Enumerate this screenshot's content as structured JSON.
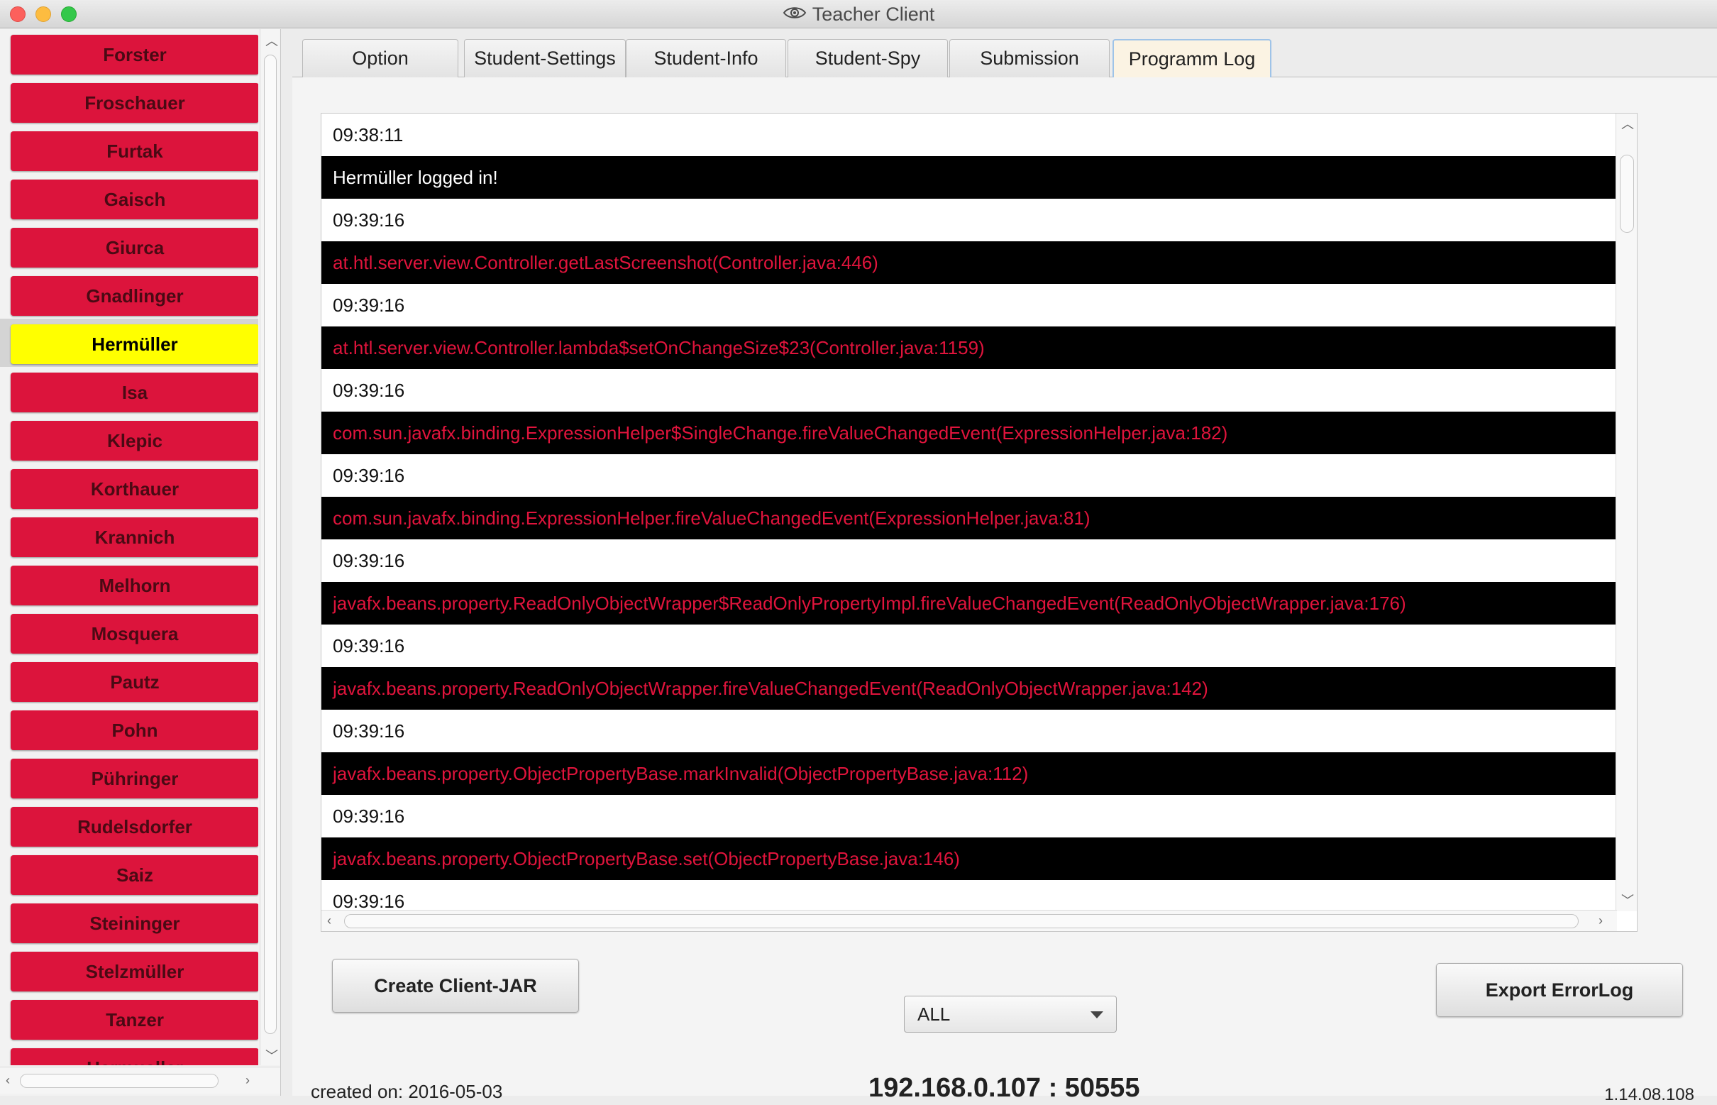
{
  "window": {
    "title": "Teacher Client",
    "title_icon": "eye-icon"
  },
  "sidebar": {
    "students": [
      {
        "name": "Forster",
        "selected": false
      },
      {
        "name": "Froschauer",
        "selected": false
      },
      {
        "name": "Furtak",
        "selected": false
      },
      {
        "name": "Gaisch",
        "selected": false
      },
      {
        "name": "Giurca",
        "selected": false
      },
      {
        "name": "Gnadlinger",
        "selected": false
      },
      {
        "name": "Hermüller",
        "selected": true
      },
      {
        "name": "Isa",
        "selected": false
      },
      {
        "name": "Klepic",
        "selected": false
      },
      {
        "name": "Korthauer",
        "selected": false
      },
      {
        "name": "Krannich",
        "selected": false
      },
      {
        "name": "Melhorn",
        "selected": false
      },
      {
        "name": "Mosquera",
        "selected": false
      },
      {
        "name": "Pautz",
        "selected": false
      },
      {
        "name": "Pohn",
        "selected": false
      },
      {
        "name": "Pühringer",
        "selected": false
      },
      {
        "name": "Rudelsdorfer",
        "selected": false
      },
      {
        "name": "Saiz",
        "selected": false
      },
      {
        "name": "Steininger",
        "selected": false
      },
      {
        "name": "Stelzmüller",
        "selected": false
      },
      {
        "name": "Tanzer",
        "selected": false
      },
      {
        "name": "Hermueller",
        "selected": false
      }
    ],
    "colors": {
      "student": "#dc143c",
      "selected": "#ffff00"
    }
  },
  "tabs": [
    {
      "label": "Option",
      "active": false
    },
    {
      "label": "Student-Settings",
      "active": false
    },
    {
      "label": "Student-Info",
      "active": false
    },
    {
      "label": "Student-Spy",
      "active": false
    },
    {
      "label": "Submission",
      "active": false
    },
    {
      "label": "Programm Log",
      "active": true
    }
  ],
  "log": {
    "entries": [
      {
        "type": "ts",
        "text": "09:38:11"
      },
      {
        "type": "msg",
        "text": "Hermüller logged in!"
      },
      {
        "type": "ts",
        "text": "09:39:16"
      },
      {
        "type": "err",
        "text": "at.htl.server.view.Controller.getLastScreenshot(Controller.java:446)"
      },
      {
        "type": "ts",
        "text": "09:39:16"
      },
      {
        "type": "err",
        "text": "at.htl.server.view.Controller.lambda$setOnChangeSize$23(Controller.java:1159)"
      },
      {
        "type": "ts",
        "text": "09:39:16"
      },
      {
        "type": "err",
        "text": "com.sun.javafx.binding.ExpressionHelper$SingleChange.fireValueChangedEvent(ExpressionHelper.java:182)"
      },
      {
        "type": "ts",
        "text": "09:39:16"
      },
      {
        "type": "err",
        "text": "com.sun.javafx.binding.ExpressionHelper.fireValueChangedEvent(ExpressionHelper.java:81)"
      },
      {
        "type": "ts",
        "text": "09:39:16"
      },
      {
        "type": "err",
        "text": "javafx.beans.property.ReadOnlyObjectWrapper$ReadOnlyPropertyImpl.fireValueChangedEvent(ReadOnlyObjectWrapper.java:176)"
      },
      {
        "type": "ts",
        "text": "09:39:16"
      },
      {
        "type": "err",
        "text": "javafx.beans.property.ReadOnlyObjectWrapper.fireValueChangedEvent(ReadOnlyObjectWrapper.java:142)"
      },
      {
        "type": "ts",
        "text": "09:39:16"
      },
      {
        "type": "err",
        "text": "javafx.beans.property.ObjectPropertyBase.markInvalid(ObjectPropertyBase.java:112)"
      },
      {
        "type": "ts",
        "text": "09:39:16"
      },
      {
        "type": "err",
        "text": "javafx.beans.property.ObjectPropertyBase.set(ObjectPropertyBase.java:146)"
      },
      {
        "type": "ts",
        "text": "09:39:16"
      }
    ],
    "colors": {
      "error_text": "#e0143c",
      "row_dark": "#000000"
    }
  },
  "actions": {
    "create_jar": "Create Client-JAR",
    "filter_value": "ALL",
    "export_errorlog": "Export ErrorLog"
  },
  "footer": {
    "created_on": "created on: 2016-05-03",
    "ip": "192.168.0.107 : 50555",
    "version": "1.14.08.108"
  }
}
